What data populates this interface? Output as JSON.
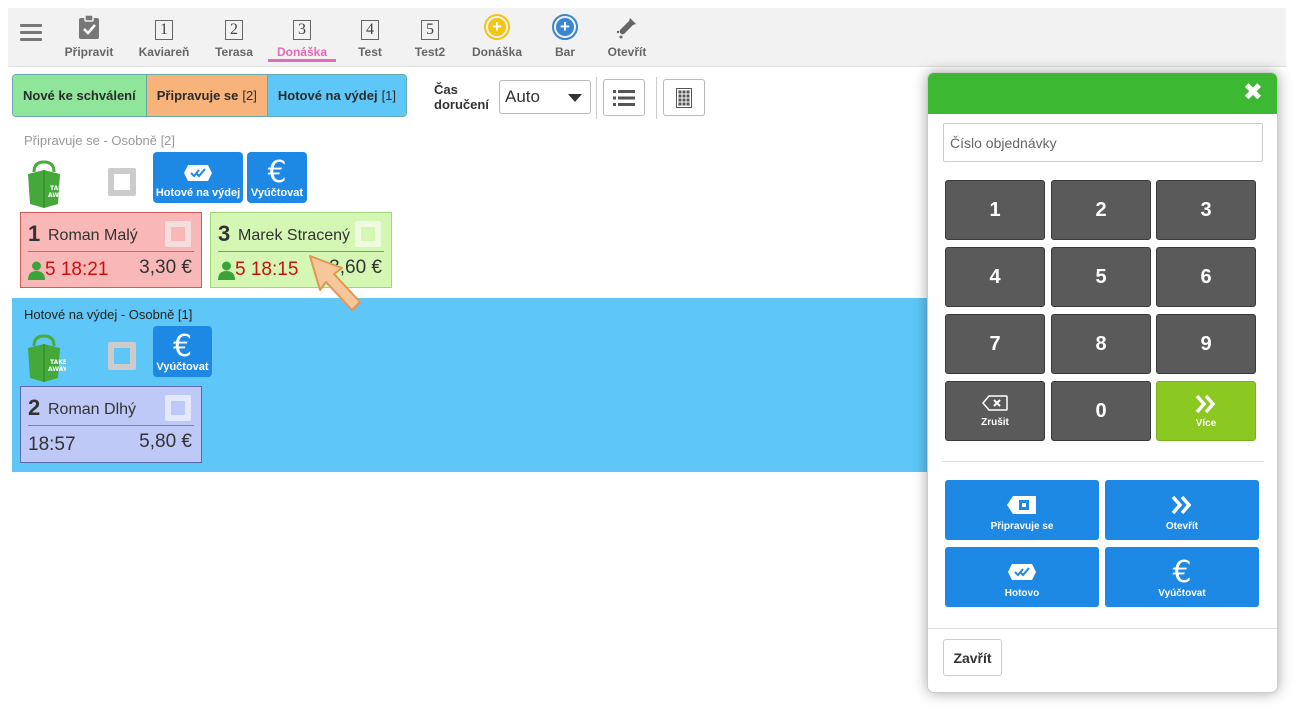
{
  "nav": {
    "items": [
      {
        "label": "Připravit"
      },
      {
        "label": "Kaviareň",
        "num": "1"
      },
      {
        "label": "Terasa",
        "num": "2"
      },
      {
        "label": "Donáška",
        "num": "3"
      },
      {
        "label": "Test",
        "num": "4"
      },
      {
        "label": "Test2",
        "num": "5"
      },
      {
        "label": "Donáška"
      },
      {
        "label": "Bar"
      },
      {
        "label": "Otevřít"
      }
    ]
  },
  "toolbar": {
    "status_new": "Nové ke schválení",
    "status_prep": "Připravuje se",
    "status_prep_count": "[2]",
    "status_done": "Hotové na výdej",
    "status_done_count": "[1]",
    "time_label_1": "Čas",
    "time_label_2": "doručení",
    "time_value": "Auto"
  },
  "section_preparing": {
    "title": "Připravuje se - Osobně [2]",
    "btn_done": "Hotové na výdej",
    "btn_bill": "Vyúčtovat",
    "cards": [
      {
        "num": "1",
        "name": "Roman Malý",
        "persons": "5",
        "time": "18:21",
        "price": "3,30 €"
      },
      {
        "num": "3",
        "name": "Marek Stracený",
        "persons": "5",
        "time": "18:15",
        "price": "3,60 €"
      }
    ]
  },
  "section_ready": {
    "title": "Hotové na výdej - Osobně [1]",
    "btn_bill": "Vyúčtovat",
    "cards": [
      {
        "num": "2",
        "name": "Roman Dlhý",
        "time": "18:57",
        "price": "5,80 €"
      }
    ]
  },
  "panel": {
    "order_placeholder": "Číslo objednávky",
    "keys": [
      "1",
      "2",
      "3",
      "4",
      "5",
      "6",
      "7",
      "8",
      "9"
    ],
    "key_zero": "0",
    "key_cancel": "Zrušit",
    "key_more": "Více",
    "action_preparing": "Připravuje se",
    "action_open": "Otevřít",
    "action_done": "Hotovo",
    "action_bill": "Vyúčtovat",
    "close_label": "Zavřít"
  },
  "colors": {
    "accent_active": "#e46bb8",
    "panel_header": "#3db832",
    "blue_button": "#1e88e5",
    "ready_band": "#5ec7f7"
  }
}
